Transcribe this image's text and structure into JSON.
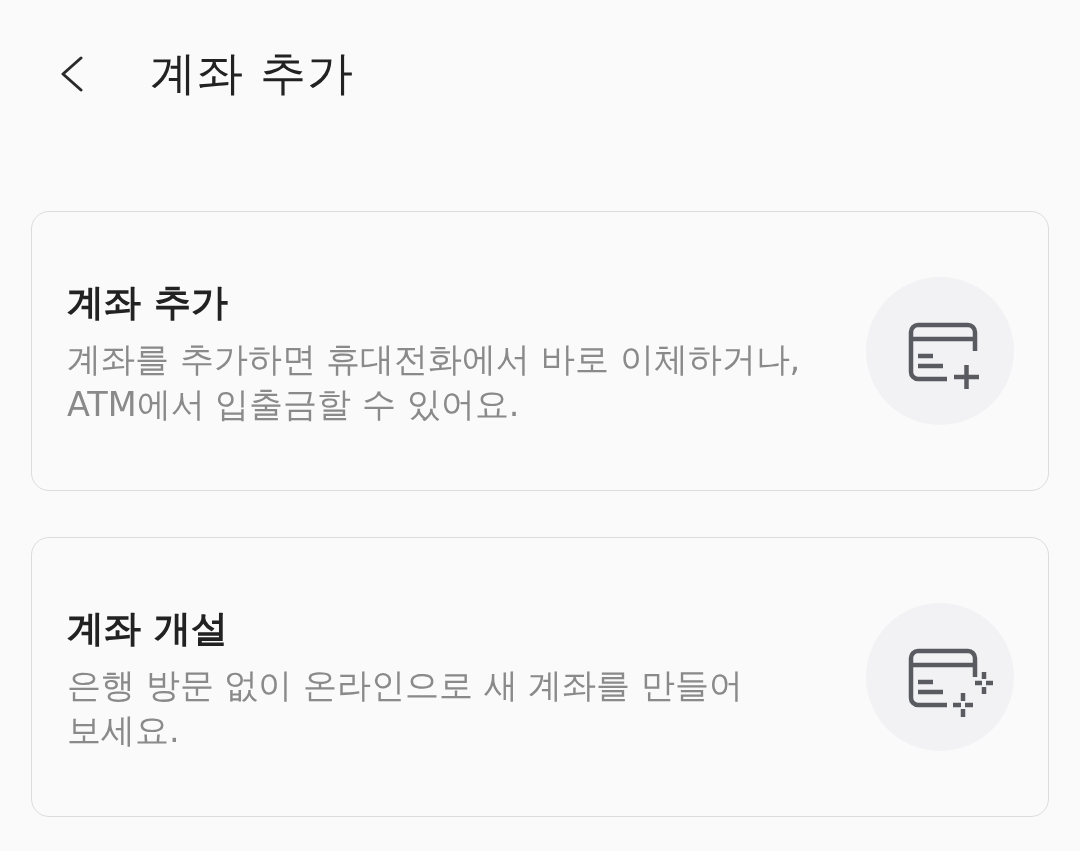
{
  "header": {
    "title": "계좌 추가"
  },
  "options": [
    {
      "kind": "add",
      "title": "계좌 추가",
      "description": "계좌를 추가하면 휴대전화에서 바로 이체하거나, ATM에서 입출금할 수 있어요."
    },
    {
      "kind": "open",
      "title": "계좌 개설",
      "description": "은행 방문 없이 온라인으로 새 계좌를 만들어 보세요."
    }
  ]
}
